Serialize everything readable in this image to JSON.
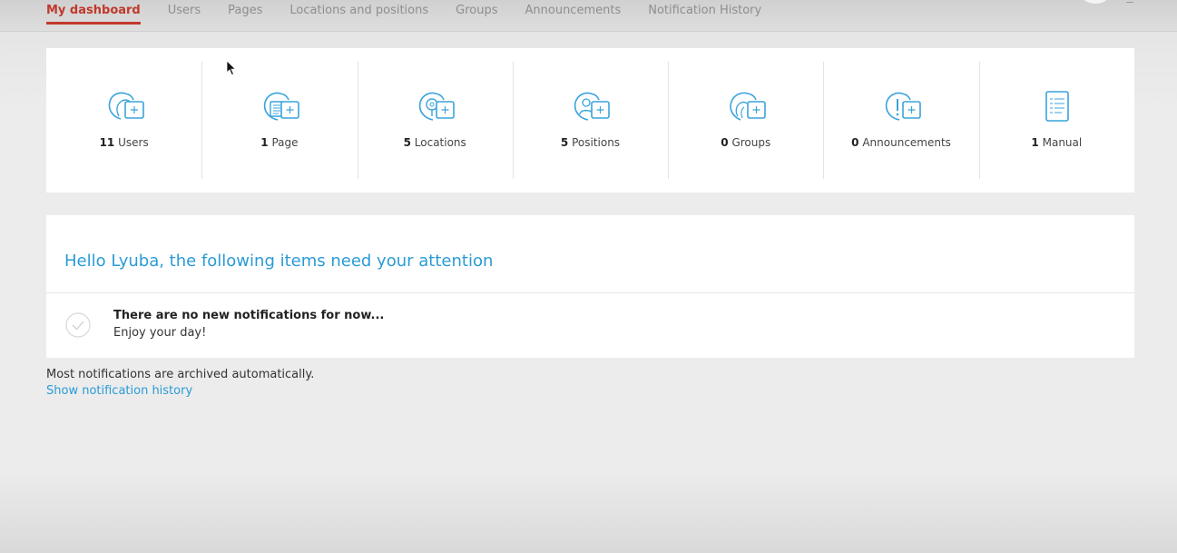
{
  "tabs": [
    {
      "label": "My dashboard",
      "active": true
    },
    {
      "label": "Users",
      "active": false
    },
    {
      "label": "Pages",
      "active": false
    },
    {
      "label": "Locations and positions",
      "active": false
    },
    {
      "label": "Groups",
      "active": false
    },
    {
      "label": "Announcements",
      "active": false
    },
    {
      "label": "Notification History",
      "active": false
    }
  ],
  "stats": [
    {
      "count": "11",
      "label": "Users",
      "icon": "users-add-icon"
    },
    {
      "count": "1",
      "label": "Page",
      "icon": "page-add-icon"
    },
    {
      "count": "5",
      "label": "Locations",
      "icon": "location-add-icon"
    },
    {
      "count": "5",
      "label": "Positions",
      "icon": "position-add-icon"
    },
    {
      "count": "0",
      "label": "Groups",
      "icon": "group-add-icon"
    },
    {
      "count": "0",
      "label": "Announcements",
      "icon": "announcement-add-icon"
    },
    {
      "count": "1",
      "label": "Manual",
      "icon": "manual-icon"
    }
  ],
  "attention": {
    "title": "Hello Lyuba, the following items need your attention",
    "empty_title": "There are no new notifications for now...",
    "empty_subtitle": "Enjoy your day!"
  },
  "footer": {
    "archived_note": "Most notifications are archived automatically.",
    "history_link": "Show notification history"
  },
  "colors": {
    "accent_red": "#c0392b",
    "link_blue": "#2a9bd6",
    "icon_blue": "#3aa3dc"
  }
}
